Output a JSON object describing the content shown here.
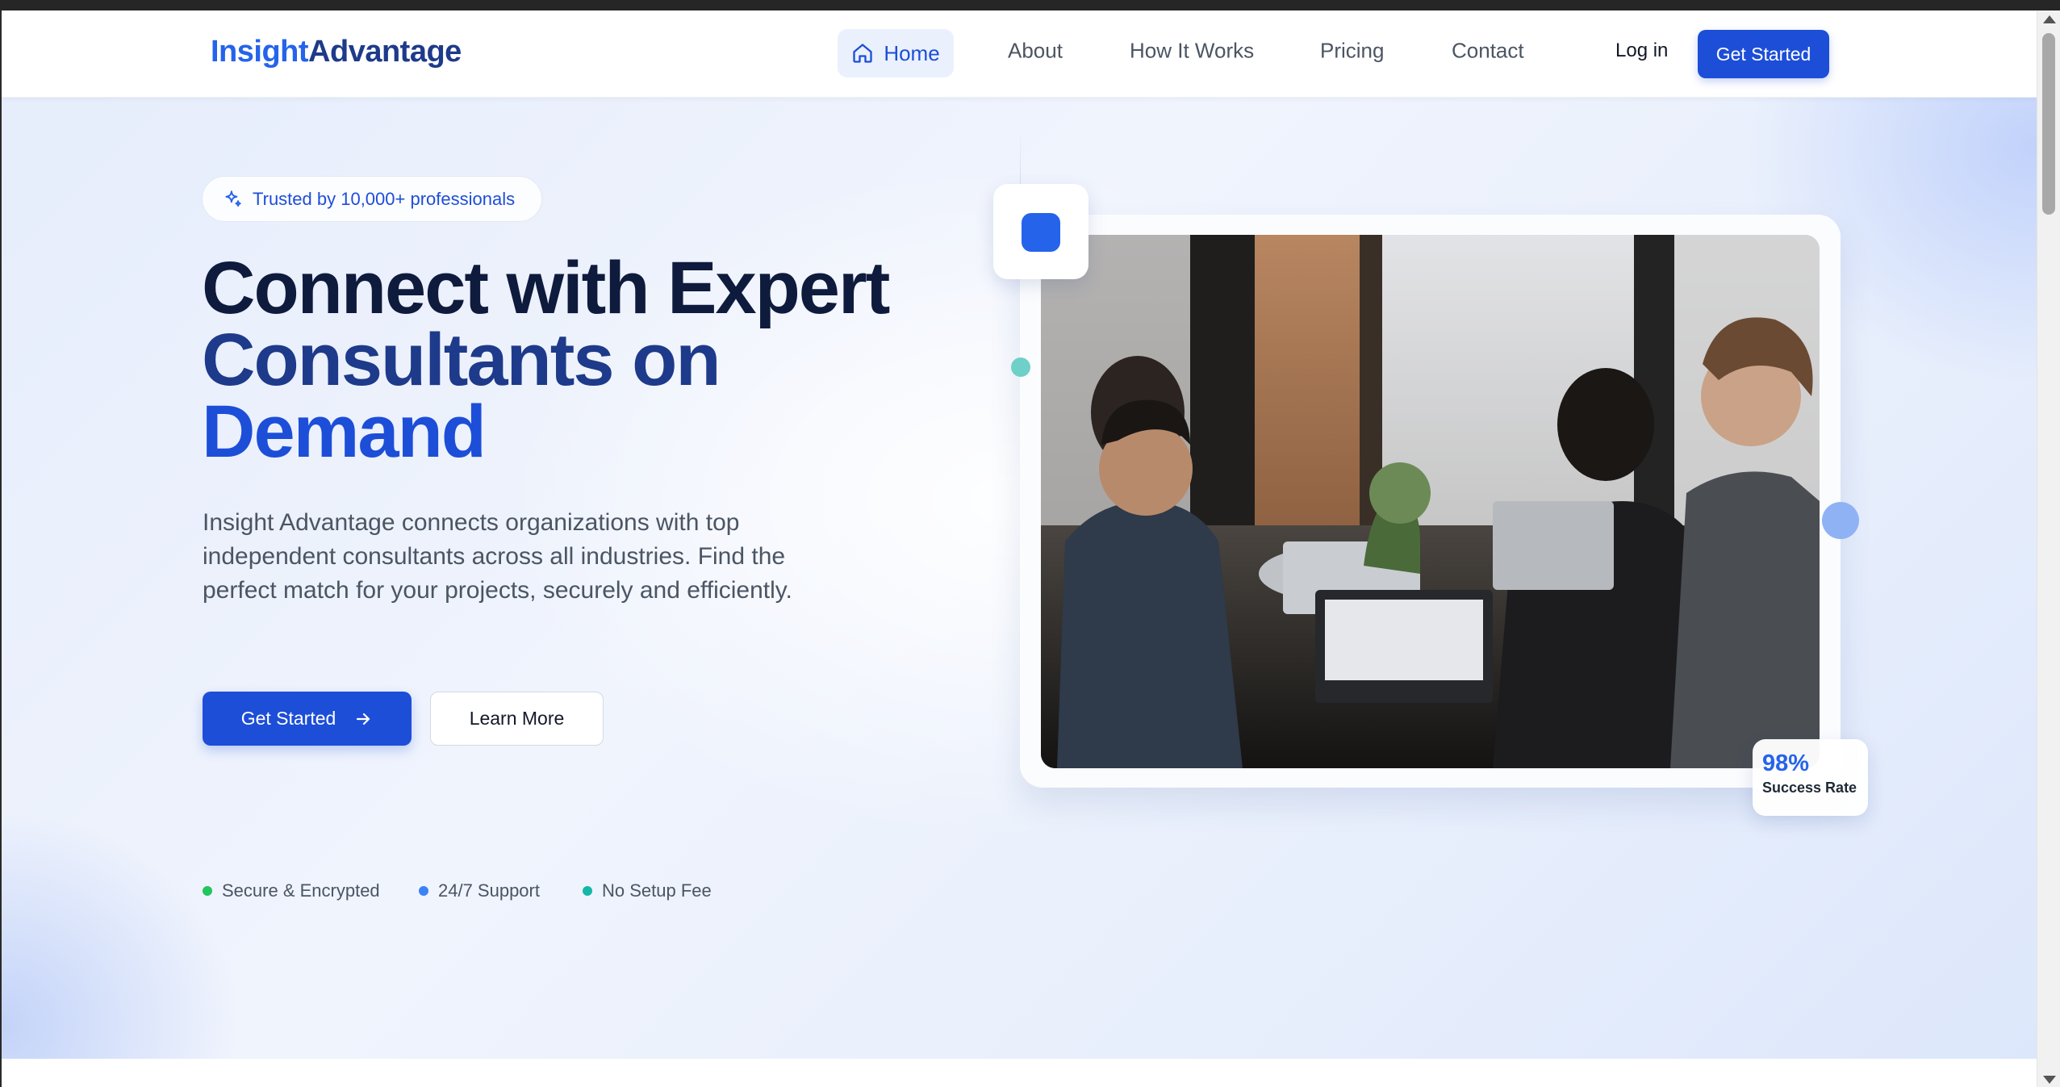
{
  "nav": {
    "logo_part1": "Insight",
    "logo_part2": "Advantage",
    "home": "Home",
    "about": "About",
    "how_it_works": "How It Works",
    "pricing": "Pricing",
    "contact": "Contact",
    "login": "Log in",
    "cta": "Get Started"
  },
  "hero": {
    "badge": "Trusted by 10,000+ professionals",
    "headline_line1": "Connect with Expert",
    "headline_line2": "Consultants on",
    "headline_line3": "Demand",
    "description": "Insight Advantage connects organizations with top independent consultants across all industries. Find the perfect match for your projects, securely and efficiently.",
    "primary_button": "Get Started",
    "secondary_button": "Learn More",
    "features": [
      {
        "label": "Secure & Encrypted",
        "color": "#22c55e"
      },
      {
        "label": "24/7 Support",
        "color": "#3b82f6"
      },
      {
        "label": "No Setup Fee",
        "color": "#14b8a6"
      }
    ],
    "stat_value": "98%",
    "stat_label": "Success Rate"
  },
  "colors": {
    "primary": "#1d4ed8",
    "accent": "#2563eb",
    "dark_navy": "#0f1b3d"
  },
  "icons": [
    "home-icon",
    "sparkle-icon",
    "arrow-right-icon"
  ]
}
